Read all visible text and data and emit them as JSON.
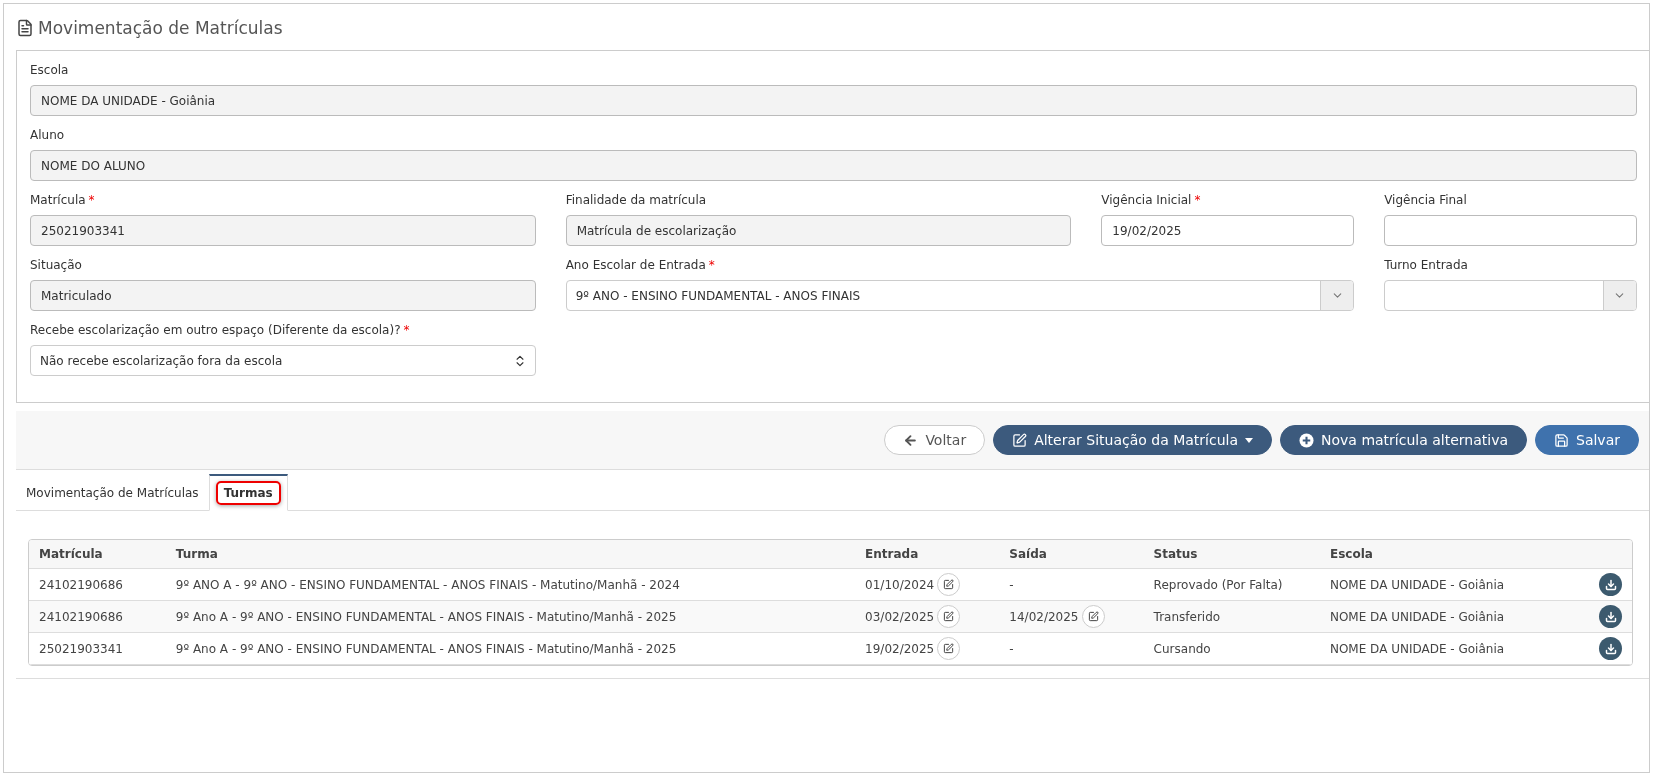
{
  "page": {
    "title": "Movimentação de Matrículas"
  },
  "form": {
    "fields": [
      {
        "label": "Escola",
        "kind": "readonly",
        "value": "NOME DA UNIDADE - Goiânia"
      },
      {
        "label": "Aluno",
        "kind": "readonly",
        "value": "NOME DO ALUNO"
      },
      {
        "label": "Matrícula",
        "required_mark": "*",
        "kind": "readonly",
        "value": "25021903341"
      },
      {
        "label": "Finalidade da matrícula",
        "kind": "readonly",
        "value": "Matrícula de escolarização"
      },
      {
        "label": "Vigência Inicial",
        "required_mark": "*",
        "kind": "input",
        "value": "19/02/2025"
      },
      {
        "label": "Vigência Final",
        "kind": "input"
      },
      {
        "label": "Situação",
        "kind": "readonly",
        "value": "Matriculado"
      },
      {
        "label": "Ano Escolar de Entrada",
        "required_mark": "*",
        "kind": "dropdown",
        "value": "9º ANO - ENSINO FUNDAMENTAL - ANOS FINAIS"
      },
      {
        "label": "Turno Entrada",
        "kind": "dropdown"
      },
      {
        "label": "Recebe escolarização em outro espaço (Diferente da escola)?",
        "required_mark": "*",
        "kind": "native-select",
        "value": "Não recebe escolarização fora da escola"
      }
    ]
  },
  "actions": [
    {
      "kind": "back",
      "label": "Voltar"
    },
    {
      "kind": "menu",
      "label": "Alterar Situação da Matrícula"
    },
    {
      "kind": "add",
      "label": "Nova matrícula alternativa"
    },
    {
      "kind": "save",
      "label": "Salvar"
    }
  ],
  "tabs": [
    {
      "label": "Movimentação de Matrículas",
      "selected": false
    },
    {
      "label": "Turmas",
      "selected": true
    }
  ],
  "table": {
    "columns": [
      "Matrícula",
      "Turma",
      "Entrada",
      "Saída",
      "Status",
      "Escola"
    ],
    "rows": [
      {
        "matricula": "24102190686",
        "turma": "9º ANO A - 9º ANO - ENSINO FUNDAMENTAL - ANOS FINAIS - Matutino/Manhã - 2024",
        "entrada": "01/10/2024",
        "entrada_editable": true,
        "saida": "-",
        "saida_editable": false,
        "status": "Reprovado (Por Falta)",
        "escola": "NOME DA UNIDADE - Goiânia"
      },
      {
        "matricula": "24102190686",
        "turma": "9º Ano A - 9º ANO - ENSINO FUNDAMENTAL - ANOS FINAIS - Matutino/Manhã - 2025",
        "entrada": "03/02/2025",
        "entrada_editable": true,
        "saida": "14/02/2025",
        "saida_editable": true,
        "status": "Transferido",
        "escola": "NOME DA UNIDADE - Goiânia"
      },
      {
        "matricula": "25021903341",
        "turma": "9º Ano A - 9º ANO - ENSINO FUNDAMENTAL - ANOS FINAIS - Matutino/Manhã - 2025",
        "entrada": "19/02/2025",
        "entrada_editable": true,
        "saida": "-",
        "saida_editable": false,
        "status": "Cursando",
        "escola": "NOME DA UNIDADE - Goiânia"
      }
    ]
  }
}
